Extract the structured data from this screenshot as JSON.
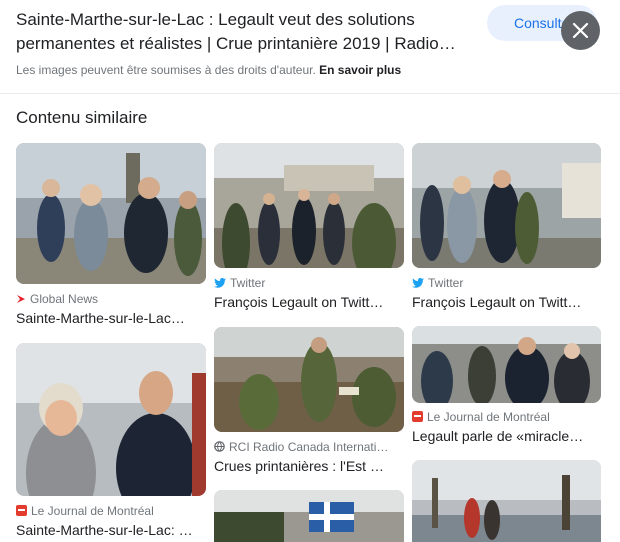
{
  "header": {
    "title": "Sainte-Marthe-sur-le-Lac : Legault veut des solutions permanentes et réalistes | Crue printanière 2019 | Radio…",
    "consult_label": "Consulter",
    "rights_text": "Les images peuvent être soumises à des droits d'auteur.",
    "rights_link": "En savoir plus"
  },
  "section": {
    "title": "Contenu similaire"
  },
  "results": [
    {
      "source": "Global News",
      "caption": "Sainte-Marthe-sur-le-Lac…",
      "source_icon": "global-news-icon",
      "icon_color": "#e8202a"
    },
    {
      "source": "Twitter",
      "caption": "François Legault on Twitt…",
      "source_icon": "twitter-icon",
      "icon_color": "#1da1f2"
    },
    {
      "source": "Twitter",
      "caption": "François Legault on Twitt…",
      "source_icon": "twitter-icon",
      "icon_color": "#1da1f2"
    },
    {
      "source": "Le Journal de Montréal",
      "caption": "Sainte-Marthe-sur-le-Lac: …",
      "source_icon": "journal-de-montreal-icon",
      "icon_color": "#e33b2e"
    },
    {
      "source": "RCI Radio Canada Internati…",
      "caption": "Crues printanières : l'Est …",
      "source_icon": "globe-icon",
      "icon_color": "#5f6368"
    },
    {
      "source": "Le Journal de Montréal",
      "caption": "Legault parle de «miracle…",
      "source_icon": "journal-de-montreal-icon",
      "icon_color": "#e33b2e"
    }
  ],
  "colors": {
    "accent": "#1a73e8",
    "consult_bg": "#e8f0fe",
    "close_bg": "#5f6368",
    "muted_text": "#70757a"
  }
}
